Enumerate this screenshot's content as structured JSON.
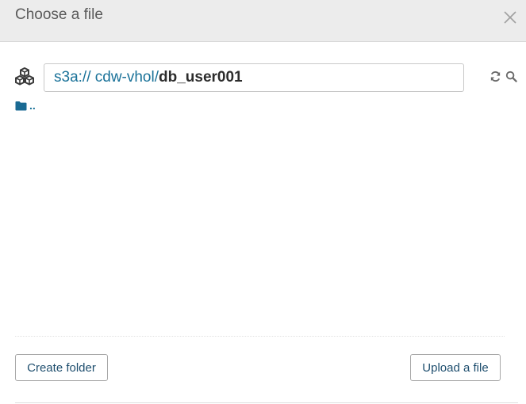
{
  "dialog": {
    "title": "Choose a file"
  },
  "path": {
    "scheme": "s3a:// ",
    "bucket": "cdw-vhol",
    "separator": "/",
    "current": "db_user001"
  },
  "files": [
    {
      "label": "..",
      "icon": "folder-icon"
    }
  ],
  "buttons": {
    "create_folder": "Create folder",
    "upload_file": "Upload a file"
  },
  "colors": {
    "link": "#1a7299",
    "header_bg": "#ececec",
    "button_text": "#1e4e6e"
  }
}
